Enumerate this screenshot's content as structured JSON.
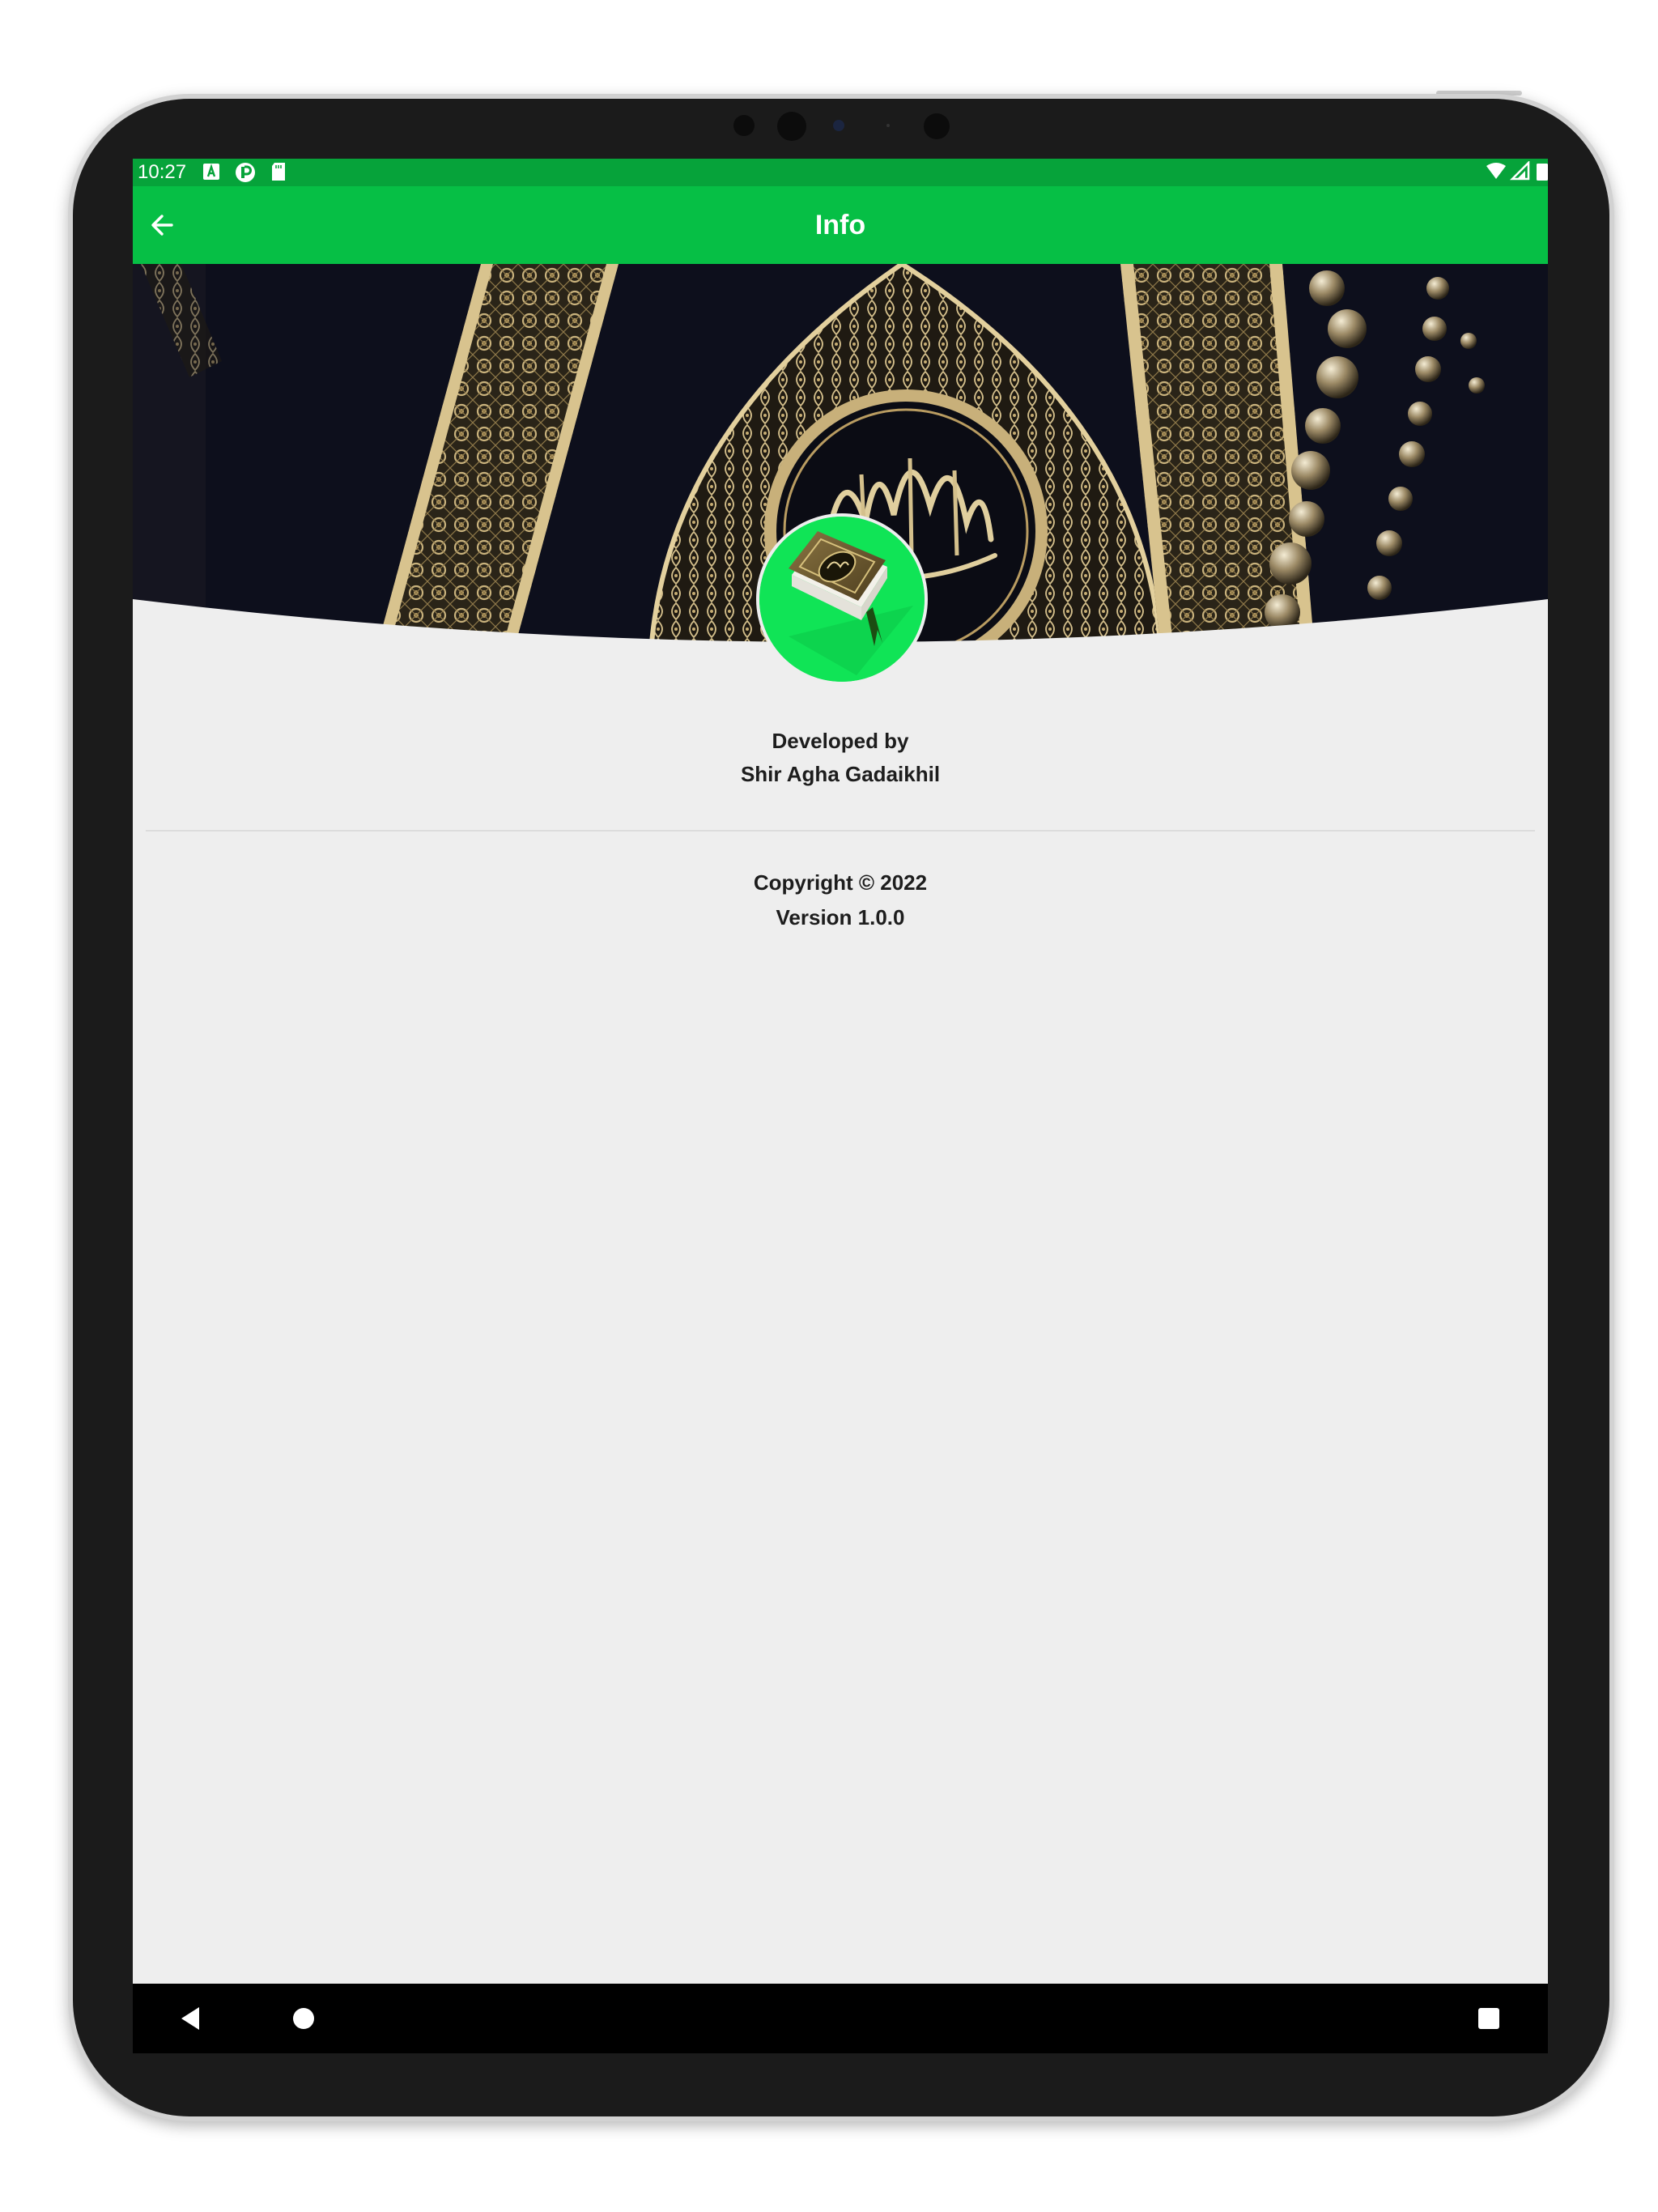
{
  "status_bar": {
    "time": "10:27",
    "left_icons": [
      "a-notification-icon",
      "p-notification-icon",
      "sd-card-icon"
    ],
    "right_icons": [
      "wifi-icon",
      "signal-icon",
      "battery-icon"
    ]
  },
  "app_bar": {
    "title": "Info",
    "back_icon": "arrow-back-icon"
  },
  "header": {
    "background": "quran-cover-image",
    "logo": "quran-book-icon"
  },
  "developer": {
    "label": "Developed by",
    "name": "Shir Agha Gadaikhil"
  },
  "footer": {
    "copyright": "Copyright © 2022",
    "version": "Version 1.0.0"
  },
  "nav_bar": {
    "buttons": [
      "nav-back-icon",
      "nav-home-icon",
      "nav-recent-icon"
    ]
  },
  "colors": {
    "status_bar": "#06a33a",
    "app_bar": "#06bf45",
    "logo_circle": "#10e456",
    "background": "#eeeeee"
  }
}
